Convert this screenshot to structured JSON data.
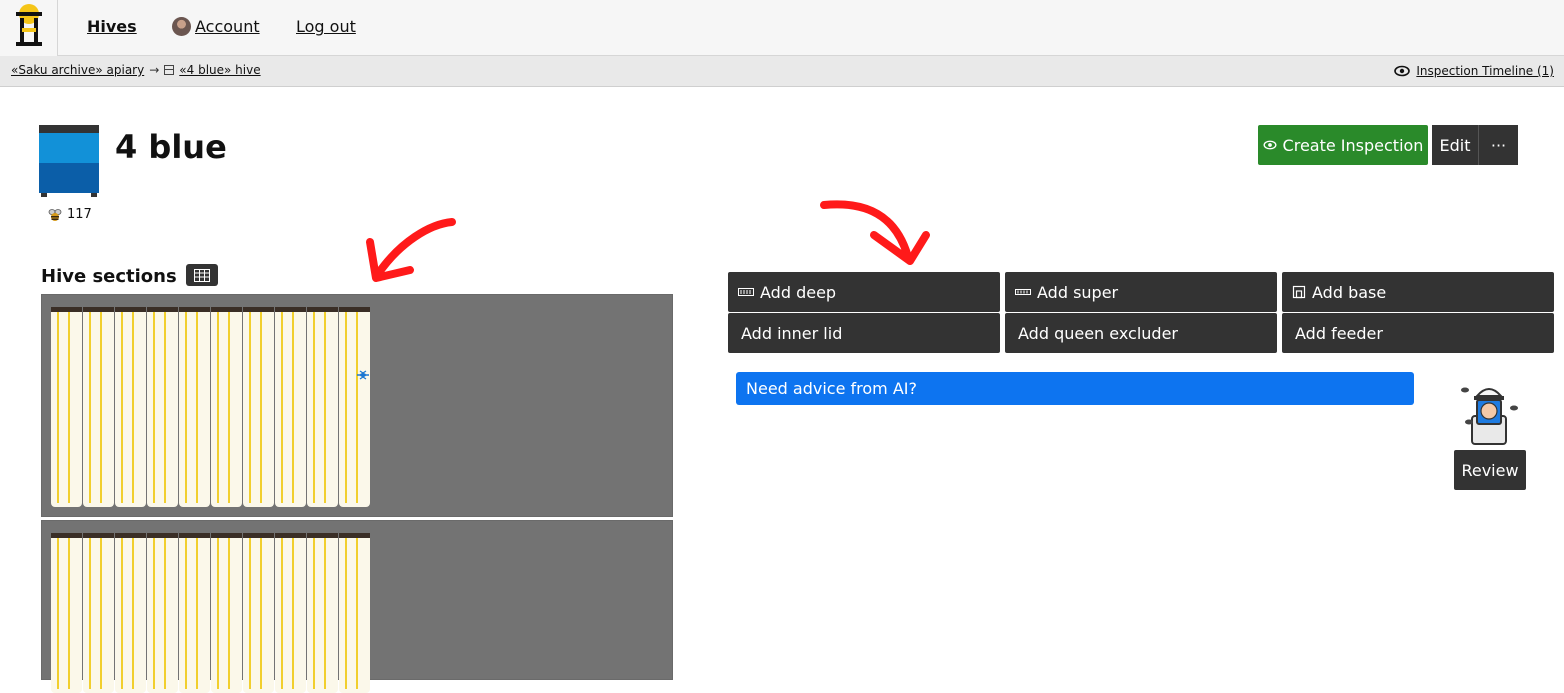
{
  "nav": {
    "hives": "Hives",
    "account": "Account",
    "logout": "Log out"
  },
  "breadcrumb": {
    "apiary": "«Saku archive» apiary",
    "separator": "→",
    "hive": "«4 blue» hive",
    "timeline": "Inspection Timeline (1)"
  },
  "hive": {
    "name": "4 blue",
    "bee_count": "117",
    "colors": {
      "top_box": "#1291d8",
      "bottom_box": "#0b5ea8"
    }
  },
  "actions": {
    "create_inspection": "Create Inspection",
    "edit": "Edit",
    "more": "···"
  },
  "sections": {
    "title": "Hive sections",
    "boxes": [
      {
        "frames": 10,
        "queen_marker_frame": 10
      },
      {
        "frames": 10
      }
    ]
  },
  "add_buttons": {
    "deep": "Add deep",
    "super": "Add super",
    "base": "Add base",
    "inner_lid": "Add inner lid",
    "queen_excluder": "Add queen excluder",
    "feeder": "Add feeder"
  },
  "ai": {
    "prompt": "Need advice from AI?",
    "review": "Review"
  },
  "colors": {
    "create_green": "#2a8a2a",
    "ai_blue": "#0d74f0",
    "dark_button": "#333333",
    "annotation_red": "#ff1a1a"
  }
}
